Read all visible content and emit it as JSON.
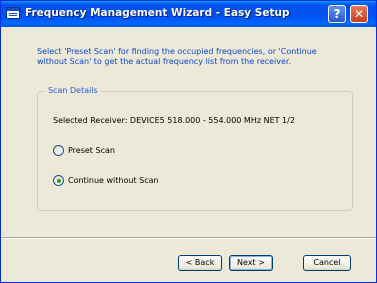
{
  "window": {
    "title": "Frequency Management Wizard - Easy Setup",
    "help_label": "?",
    "close_label": "✕"
  },
  "instruction": "Select 'Preset  Scan' for finding the occupied frequencies, or 'Continue without Scan' to get the actual frequency list from the receiver.",
  "scan_details": {
    "title": "Scan Details",
    "receiver_text": "Selected Receiver:  DEVICE5 518.000 - 554.000 MHz NET 1/2",
    "options": [
      {
        "label": "Preset Scan",
        "checked": false
      },
      {
        "label": "Continue without Scan",
        "checked": true
      }
    ]
  },
  "buttons": {
    "back": "< Back",
    "next": "Next >",
    "cancel": "Cancel"
  }
}
